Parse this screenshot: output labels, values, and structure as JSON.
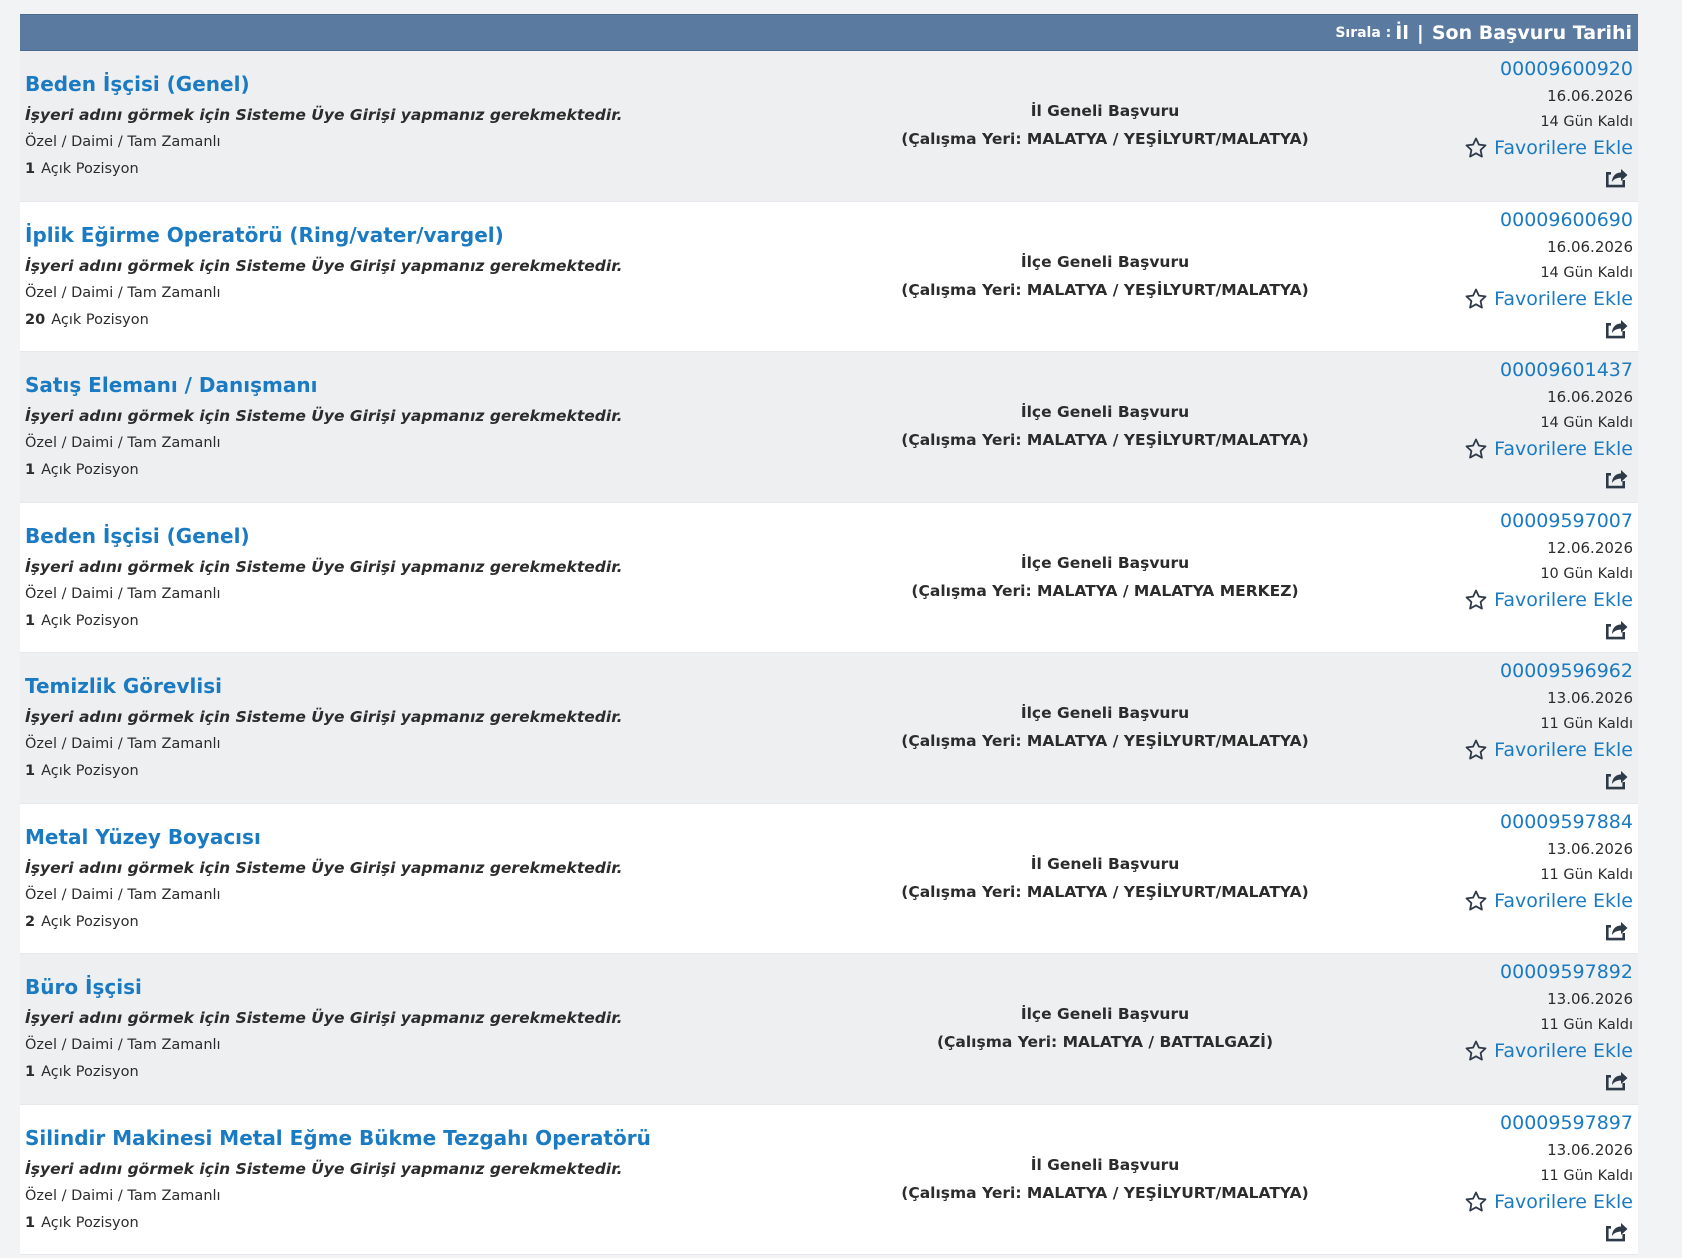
{
  "sort_bar": {
    "label": "Sırala :",
    "option_1": "İl",
    "separator": "|",
    "option_2": "Son Başvuru Tarihi"
  },
  "listings": [
    {
      "title": "Beden İşçisi (Genel)",
      "employer_note": "İşyeri adını görmek için Sisteme Üye Girişi yapmanız gerekmektedir.",
      "job_type": "Özel / Daimi / Tam Zamanlı",
      "position_count": "1",
      "position_label": "Açık Pozisyon",
      "scope": "İl Geneli Başvuru",
      "workplace": "(Çalışma Yeri: MALATYA / YEŞİLYURT/MALATYA)",
      "listing_no": "00009600920",
      "deadline": "16.06.2026",
      "days_left": "14 Gün Kaldı",
      "favorite_label": "Favorilere Ekle"
    },
    {
      "title": "İplik Eğirme Operatörü (Ring/vater/vargel)",
      "employer_note": "İşyeri adını görmek için Sisteme Üye Girişi yapmanız gerekmektedir.",
      "job_type": "Özel / Daimi / Tam Zamanlı",
      "position_count": "20",
      "position_label": "Açık Pozisyon",
      "scope": "İlçe Geneli Başvuru",
      "workplace": "(Çalışma Yeri: MALATYA / YEŞİLYURT/MALATYA)",
      "listing_no": "00009600690",
      "deadline": "16.06.2026",
      "days_left": "14 Gün Kaldı",
      "favorite_label": "Favorilere Ekle"
    },
    {
      "title": "Satış Elemanı / Danışmanı",
      "employer_note": "İşyeri adını görmek için Sisteme Üye Girişi yapmanız gerekmektedir.",
      "job_type": "Özel / Daimi / Tam Zamanlı",
      "position_count": "1",
      "position_label": "Açık Pozisyon",
      "scope": "İlçe Geneli Başvuru",
      "workplace": "(Çalışma Yeri: MALATYA / YEŞİLYURT/MALATYA)",
      "listing_no": "00009601437",
      "deadline": "16.06.2026",
      "days_left": "14 Gün Kaldı",
      "favorite_label": "Favorilere Ekle"
    },
    {
      "title": "Beden İşçisi (Genel)",
      "employer_note": "İşyeri adını görmek için Sisteme Üye Girişi yapmanız gerekmektedir.",
      "job_type": "Özel / Daimi / Tam Zamanlı",
      "position_count": "1",
      "position_label": "Açık Pozisyon",
      "scope": "İlçe Geneli Başvuru",
      "workplace": "(Çalışma Yeri: MALATYA / MALATYA MERKEZ)",
      "listing_no": "00009597007",
      "deadline": "12.06.2026",
      "days_left": "10 Gün Kaldı",
      "favorite_label": "Favorilere Ekle"
    },
    {
      "title": "Temizlik Görevlisi",
      "employer_note": "İşyeri adını görmek için Sisteme Üye Girişi yapmanız gerekmektedir.",
      "job_type": "Özel / Daimi / Tam Zamanlı",
      "position_count": "1",
      "position_label": "Açık Pozisyon",
      "scope": "İlçe Geneli Başvuru",
      "workplace": "(Çalışma Yeri: MALATYA / YEŞİLYURT/MALATYA)",
      "listing_no": "00009596962",
      "deadline": "13.06.2026",
      "days_left": "11 Gün Kaldı",
      "favorite_label": "Favorilere Ekle"
    },
    {
      "title": "Metal Yüzey Boyacısı",
      "employer_note": "İşyeri adını görmek için Sisteme Üye Girişi yapmanız gerekmektedir.",
      "job_type": "Özel / Daimi / Tam Zamanlı",
      "position_count": "2",
      "position_label": "Açık Pozisyon",
      "scope": "İl Geneli Başvuru",
      "workplace": "(Çalışma Yeri: MALATYA / YEŞİLYURT/MALATYA)",
      "listing_no": "00009597884",
      "deadline": "13.06.2026",
      "days_left": "11 Gün Kaldı",
      "favorite_label": "Favorilere Ekle"
    },
    {
      "title": "Büro İşçisi",
      "employer_note": "İşyeri adını görmek için Sisteme Üye Girişi yapmanız gerekmektedir.",
      "job_type": "Özel / Daimi / Tam Zamanlı",
      "position_count": "1",
      "position_label": "Açık Pozisyon",
      "scope": "İlçe Geneli Başvuru",
      "workplace": "(Çalışma Yeri: MALATYA / BATTALGAZİ)",
      "listing_no": "00009597892",
      "deadline": "13.06.2026",
      "days_left": "11 Gün Kaldı",
      "favorite_label": "Favorilere Ekle"
    },
    {
      "title": "Silindir Makinesi Metal Eğme Bükme Tezgahı Operatörü",
      "employer_note": "İşyeri adını görmek için Sisteme Üye Girişi yapmanız gerekmektedir.",
      "job_type": "Özel / Daimi / Tam Zamanlı",
      "position_count": "1",
      "position_label": "Açık Pozisyon",
      "scope": "İl Geneli Başvuru",
      "workplace": "(Çalışma Yeri: MALATYA / YEŞİLYURT/MALATYA)",
      "listing_no": "00009597897",
      "deadline": "13.06.2026",
      "days_left": "11 Gün Kaldı",
      "favorite_label": "Favorilere Ekle"
    }
  ],
  "icons": {
    "favorite": "star-outline-icon",
    "share": "share-icon"
  },
  "colors": {
    "header_bar": "#5b7aa0",
    "link": "#1a7ac2",
    "row_shade": "#eeeff1",
    "row_plain": "#ffffff"
  }
}
